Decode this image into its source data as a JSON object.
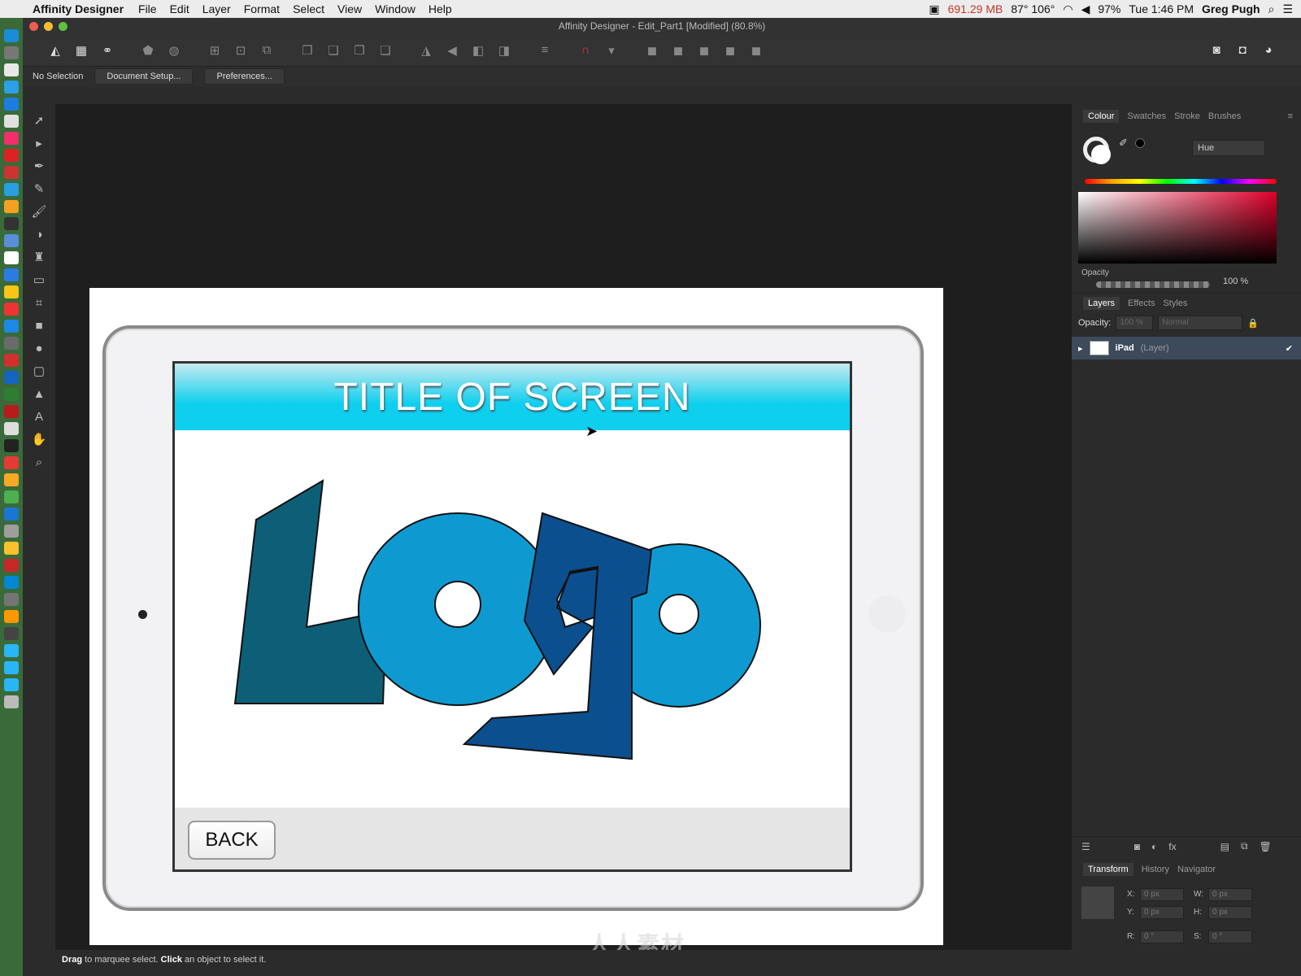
{
  "menubar": {
    "apple": "",
    "app_name": "Affinity Designer",
    "items": [
      "File",
      "Edit",
      "Layer",
      "Format",
      "Select",
      "View",
      "Window",
      "Help"
    ],
    "memory": "691.29 MB",
    "temps": "87° 106°",
    "battery": "97%",
    "clock": "Tue 1:46 PM",
    "user": "Greg Pugh"
  },
  "window": {
    "title": "Affinity Designer - Edit_Part1 [Modified] (80.8%)"
  },
  "context_bar": {
    "selection": "No Selection",
    "document_setup": "Document Setup...",
    "preferences": "Preferences..."
  },
  "canvas": {
    "screen_title": "TITLE OF SCREEN",
    "back_button": "BACK",
    "logo_colors": {
      "letter_l": "#0d5f78",
      "letter_o": "#0e9ad0",
      "letter_g": "#0b4f8e"
    },
    "header_color": "#0fcfee",
    "watermark": "人人素材"
  },
  "colour_panel": {
    "tabs": [
      "Colour",
      "Swatches",
      "Stroke",
      "Brushes"
    ],
    "mode": "Hue",
    "opacity_label": "Opacity",
    "opacity_value": "100 %"
  },
  "layers_panel": {
    "tabs": [
      "Layers",
      "Effects",
      "Styles"
    ],
    "opacity_label": "Opacity:",
    "opacity_value": "100 %",
    "blend_mode": "Normal",
    "layer": {
      "name": "iPad",
      "type": "(Layer)"
    }
  },
  "transform_panel": {
    "tabs": [
      "Transform",
      "History",
      "Navigator"
    ],
    "x": "0 px",
    "y": "0 px",
    "w": "0 px",
    "h": "0 px",
    "r": "0 °",
    "s": "0 °"
  },
  "status": {
    "drag": "Drag",
    "drag_text": " to marquee select. ",
    "click": "Click",
    "click_text": " an object to select it."
  }
}
